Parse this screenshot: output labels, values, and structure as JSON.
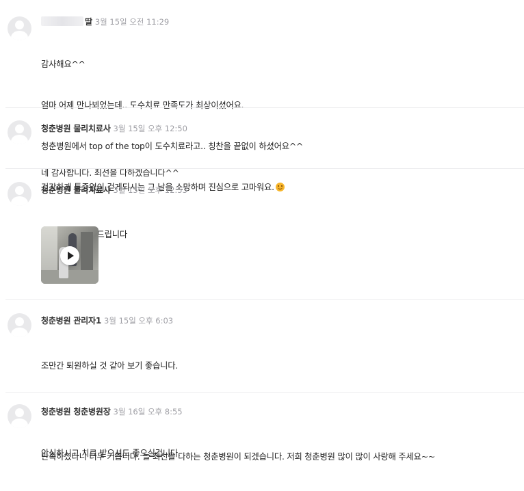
{
  "comments": [
    {
      "author": "딸",
      "author_blurred": true,
      "time": "3월 15일 오전 11:29",
      "lines": [
        "감사해요^^",
        "엄마 어제 만나뵈었는데.. 도수치료 만족도가 최상이셨어요.",
        "청춘병원에서 top of the top이 도수치료라고.. 칭찬을 끝없이 하셨어요^^",
        "건강하게 통증없이 걷게되시는 그 날을 소망하며 진심으로 고마워요."
      ],
      "emoji_icon": "smiling-face-emoji"
    },
    {
      "author": "청춘병원 물리치료사",
      "time": "3월 15일 오후 12:50",
      "lines": [
        "네 감사합니다. 최선을 다하겠습니다^^"
      ]
    },
    {
      "author": "청춘병원 물리치료사",
      "time": "3월 15일 오후 12:53",
      "lines": [
        "운동영상도 보여드립니다"
      ],
      "attachment": {
        "type": "video",
        "icon": "play-icon"
      }
    },
    {
      "author": "청춘병원 관리자1",
      "time": "3월 15일 오후 6:03",
      "lines": [
        "조만간 퇴원하실 것 같아 보기 좋습니다.",
        "",
        "안심하시고 치료 받으셔도 좋으실겁니다."
      ]
    },
    {
      "author": "청춘병원 청춘병원장",
      "time": "3월 16일 오후 8:55",
      "lines": [
        "만족하셨다니 너무 기쁩니다. 늘 최선을 다하는 청춘병원이 되겠습니다. 저희 청춘병원 많이 많이 사랑해 주세요~~"
      ]
    }
  ],
  "colors": {
    "avatar_bg": "#e9e9eb",
    "time_text": "#a0a0a6",
    "divider": "#ececee"
  }
}
